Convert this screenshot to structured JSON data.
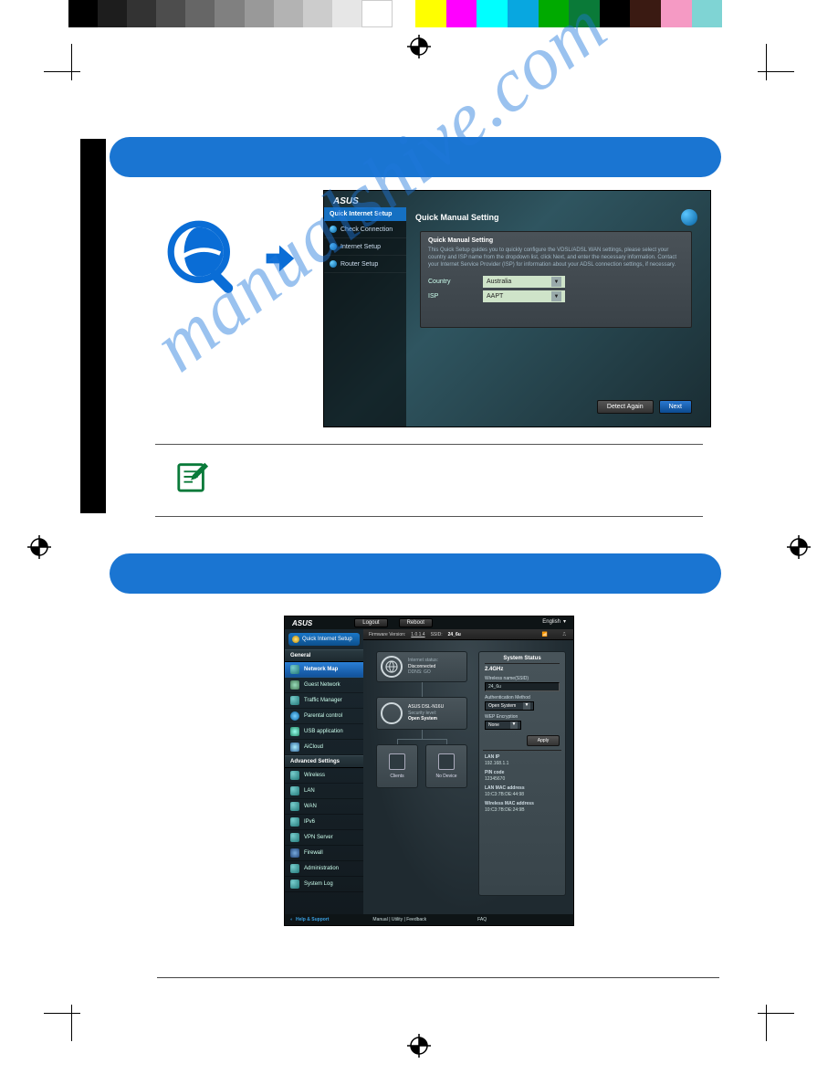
{
  "watermark": "manualshive.com",
  "screenshot1": {
    "brand": "ASUS",
    "sidebar_header": "Quick Internet Setup",
    "sidebar_items": [
      "Check Connection",
      "Internet Setup",
      "Router Setup"
    ],
    "main_title": "Quick Manual Setting",
    "panel_header": "Quick Manual Setting",
    "panel_text": "This Quick Setup guides you to quickly configure the VDSL/ADSL WAN settings, please select your country and ISP name from the dropdown list, click Next, and enter the necessary information. Contact your Internet Service Provider (ISP) for information about your ADSL connection settings, if necessary.",
    "fields": {
      "country_label": "Country",
      "country_value": "Australia",
      "isp_label": "ISP",
      "isp_value": "AAPT"
    },
    "buttons": {
      "detect": "Detect Again",
      "next": "Next"
    }
  },
  "screenshot2": {
    "brand": "ASUS",
    "topbar": {
      "logout": "Logout",
      "reboot": "Reboot",
      "language": "English"
    },
    "fwbar": {
      "label": "Firmware Version:",
      "version": "1.0.1.4",
      "ssid_label": "SSID:",
      "ssid": "24_6u"
    },
    "qis_button": "Quick Internet Setup",
    "group_general": "General",
    "general_items": [
      "Network Map",
      "Guest Network",
      "Traffic Manager",
      "Parental control",
      "USB application",
      "AiCloud"
    ],
    "group_advanced": "Advanced Settings",
    "advanced_items": [
      "Wireless",
      "LAN",
      "WAN",
      "IPv6",
      "VPN Server",
      "Firewall",
      "Administration",
      "System Log"
    ],
    "globe": {
      "line1": "Internet status:",
      "line2": "Disconnected",
      "line3": "DDNS: GO"
    },
    "device": {
      "name": "ASUS DSL-N16U",
      "sec_label": "Security level:",
      "sec_value": "Open System"
    },
    "clients_label": "Clients",
    "usb_label": "No Device",
    "status": {
      "header": "System Status",
      "tab": "2.4GHz",
      "wname_label": "Wireless name(SSID)",
      "wname_value": "24_6u",
      "auth_label": "Authentication Method",
      "auth_value": "Open System",
      "wep_label": "WEP Encryption",
      "wep_value": "None",
      "apply": "Apply",
      "lanip_label": "LAN IP",
      "lanip_value": "192.168.1.1",
      "pin_label": "PIN code",
      "pin_value": "12345670",
      "lanmac_label": "LAN MAC address",
      "lanmac_value": "10:C3:7B:DE:44:98",
      "wmac_label": "Wireless MAC address",
      "wmac_value": "10:C3:7B:DE:24:9B"
    },
    "footer": {
      "help": "Help & Support",
      "links": "Manual | Utility | Feedback",
      "faq": "FAQ"
    }
  }
}
